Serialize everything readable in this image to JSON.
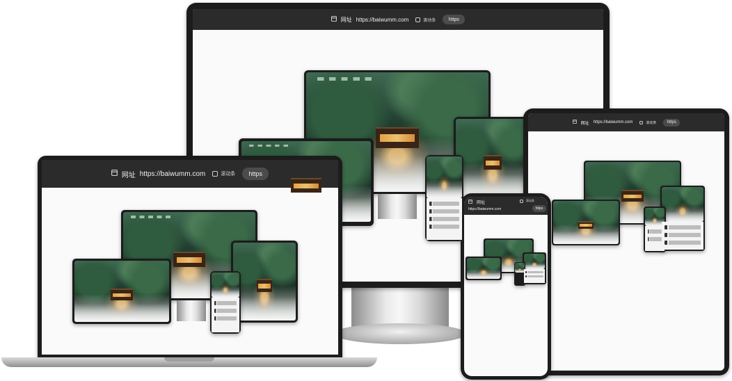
{
  "devices": {
    "monitor": {
      "url_label": "网址",
      "url": "https://baiwumm.com",
      "scroll_label": "滚动条",
      "https_label": "https"
    },
    "laptop": {
      "url_label": "网址",
      "url": "https://baiwumm.com",
      "scroll_label": "滚动条",
      "https_label": "https"
    },
    "tablet": {
      "url_label": "网址",
      "url": "https://baiwumm.com",
      "scroll_label": "滚动条",
      "https_label": "https"
    },
    "phone": {
      "url_label": "网址",
      "url": "https://baiwumm.com",
      "scroll_label": "滚动条",
      "https_label": "https"
    }
  },
  "icons": {
    "web": "web-page-icon",
    "scroll": "checkbox-icon"
  },
  "colors": {
    "bar_bg": "#2b2b2b",
    "pill_bg": "#4b4b4b",
    "frame": "#1c1c1c",
    "accent_lantern": "#f5b656"
  }
}
